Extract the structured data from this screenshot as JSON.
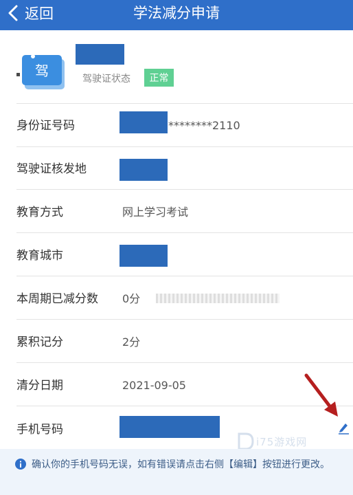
{
  "nav": {
    "back_label": "返回",
    "title": "学法减分申请"
  },
  "profile": {
    "license_icon_char": "驾",
    "status_label": "驾驶证状态",
    "status_value": "正常"
  },
  "rows": [
    {
      "label": "身份证号码",
      "value": "********2110"
    },
    {
      "label": "驾驶证核发地",
      "value": ""
    },
    {
      "label": "教育方式",
      "value": "网上学习考试"
    },
    {
      "label": "教育城市",
      "value": ""
    },
    {
      "label": "本周期已减分数",
      "value": "0分"
    },
    {
      "label": "累积记分",
      "value": "2分"
    },
    {
      "label": "清分日期",
      "value": "2021-09-05"
    },
    {
      "label": "手机号码",
      "value": ""
    }
  ],
  "notice": {
    "text": "确认你的手机号码无误，如有错误请点击右侧【编辑】按钮进行更改。"
  },
  "watermark": {
    "text": "i75游戏网"
  },
  "colors": {
    "nav_bg": "#2f6fc9",
    "redaction": "#2c6ab9",
    "status_badge": "#5fd093",
    "annotation_arrow": "#b51f1f",
    "notice_bg": "#eef4fb"
  },
  "icons": {
    "back": "chevron-left-icon",
    "license": "driver-license-icon",
    "edit": "pen-edit-icon",
    "info": "info-icon"
  }
}
